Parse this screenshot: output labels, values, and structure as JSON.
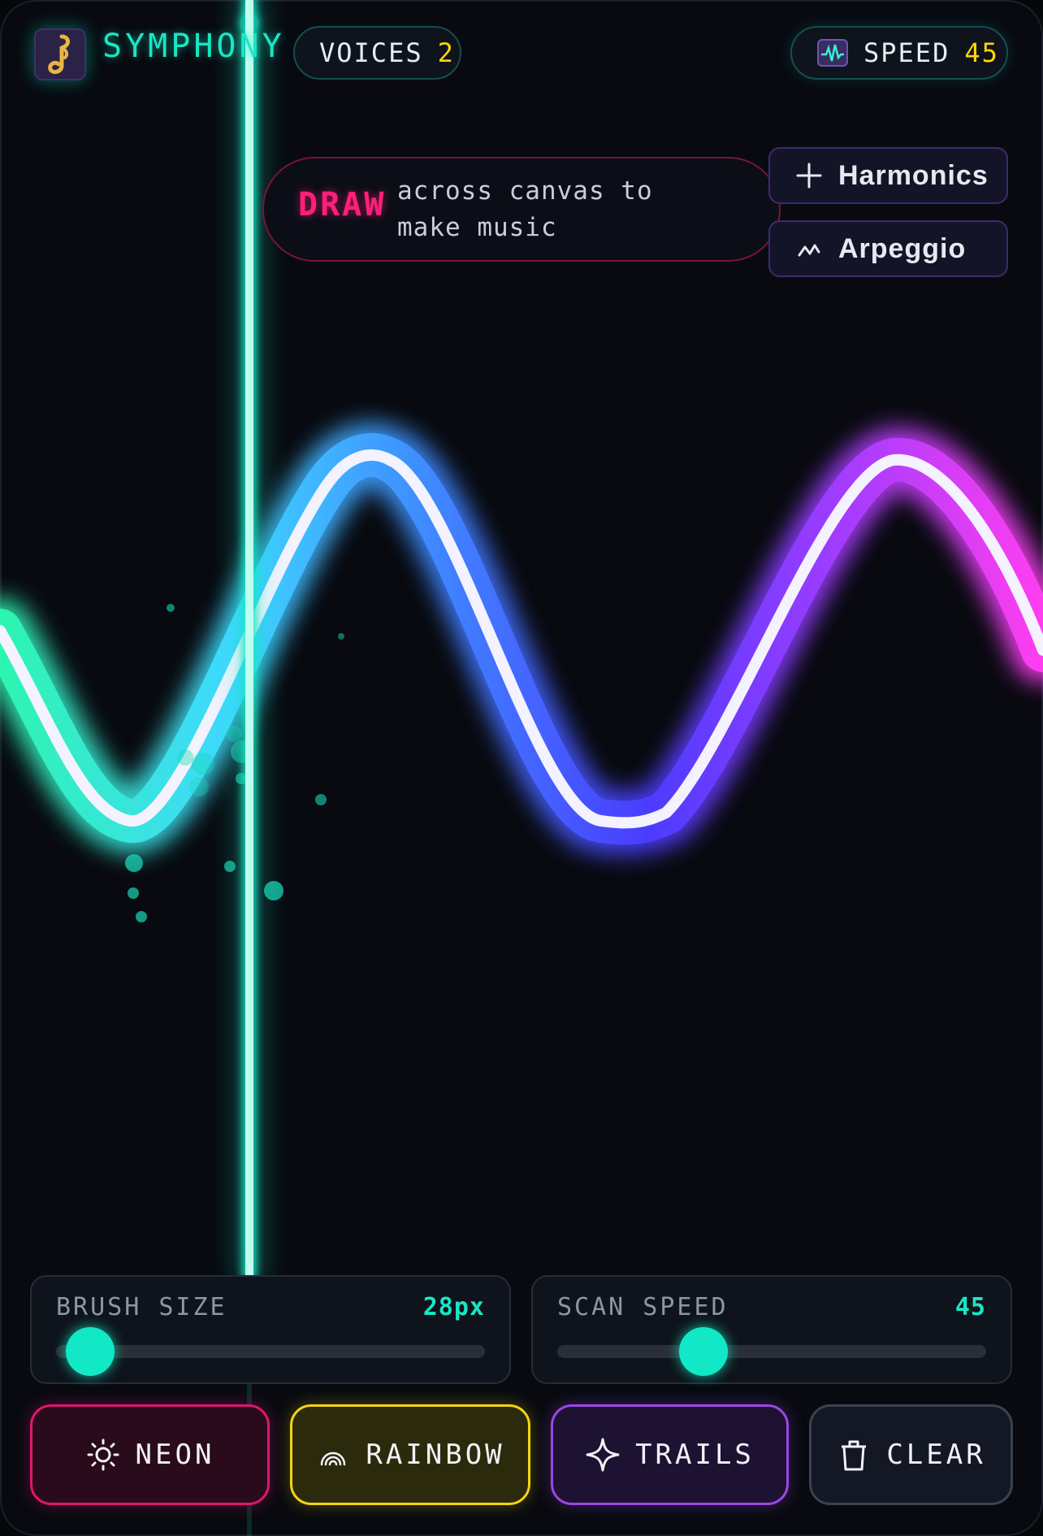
{
  "header": {
    "app_title": "SYMPHONY",
    "voices_label": "VOICES",
    "voices_value": "2",
    "speed_label": "SPEED",
    "speed_value": "45",
    "logo_icon": "music-note-icon",
    "speed_icon": "waveform-monitor-icon"
  },
  "hint": {
    "draw_word": "DRAW",
    "text": "across canvas to make music"
  },
  "side_buttons": {
    "harmonics": {
      "label": "Harmonics",
      "icon": "plus-icon"
    },
    "arpeggio": {
      "label": "Arpeggio",
      "icon": "arpeggio-icon"
    }
  },
  "sliders": {
    "brush": {
      "label": "BRUSH SIZE",
      "value": "28px",
      "level": 0.08
    },
    "scan": {
      "label": "SCAN SPEED",
      "value": "45",
      "level": 0.34
    }
  },
  "buttons": {
    "neon": {
      "label": "NEON",
      "icon": "sun-icon"
    },
    "rainbow": {
      "label": "RAINBOW",
      "icon": "rainbow-icon"
    },
    "trails": {
      "label": "TRAILS",
      "icon": "sparkle-icon"
    },
    "clear": {
      "label": "CLEAR",
      "icon": "trash-icon"
    }
  },
  "colors": {
    "accent": "#19e6c4",
    "draw_pink": "#ff1f7a",
    "number_yellow": "#ffd60a",
    "wave_start": "#2ef5b0",
    "wave_mid": "#3a52ff",
    "wave_end": "#ff3ef0"
  }
}
